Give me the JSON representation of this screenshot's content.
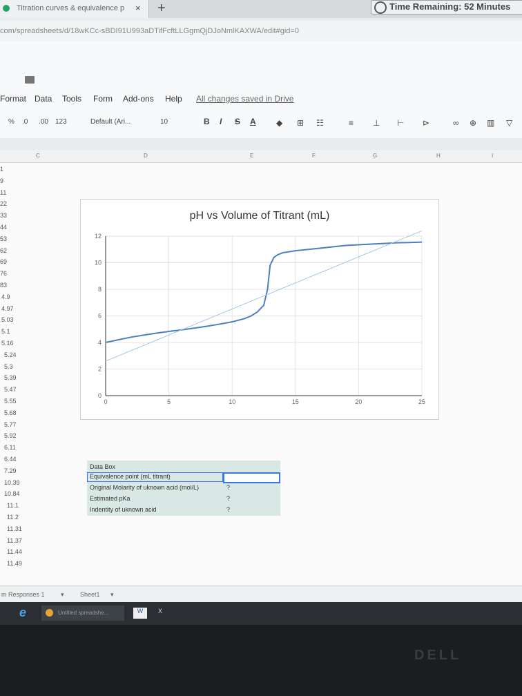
{
  "browser": {
    "tab_title": "Titration curves & equivalence p",
    "tab_close": "×",
    "new_tab": "+",
    "timer": "Time Remaining: 52 Minutes",
    "url": "com/spreadsheets/d/18wKCc-sBDI91U993aDTifFcftLLGgmQjDJoNmlKAXWA/edit#gid=0"
  },
  "menu": {
    "items": [
      "Format",
      "Data",
      "Tools",
      "Form",
      "Add-ons",
      "Help"
    ],
    "saved_status": "All changes saved in Drive"
  },
  "toolbar": {
    "percent": "%",
    "dec_less": ".0",
    "dec_more": ".00",
    "format": "123",
    "font": "Default (Ari...",
    "font_size": "10",
    "bold": "B",
    "italic": "I",
    "strike": "S",
    "text_color": "A"
  },
  "columns": [
    "C",
    "D",
    "E",
    "F",
    "G",
    "H",
    "I"
  ],
  "column_values": [
    "1",
    "9",
    "11",
    "22",
    "33",
    "44",
    "53",
    "62",
    "69",
    "76",
    "83",
    "4.9",
    "4.97",
    "5.03",
    "5.1",
    "5.16",
    "5.24",
    "5.3",
    "5.39",
    "5.47",
    "5.55",
    "5.68",
    "5.77",
    "5.92",
    "6.11",
    "6.44",
    "7.29",
    "10.39",
    "10.84",
    "11.1",
    "11.2",
    "11.31",
    "11.37",
    "11.44",
    "11.49"
  ],
  "chart_data": {
    "type": "line",
    "title": "pH vs Volume of Titrant (mL)",
    "xlabel": "",
    "ylabel": "",
    "xlim": [
      0,
      25
    ],
    "ylim": [
      0,
      12
    ],
    "x_ticks": [
      0,
      5,
      10,
      15,
      20,
      25
    ],
    "y_ticks": [
      0,
      2,
      4,
      6,
      8,
      10,
      12
    ],
    "grid": true,
    "series": [
      {
        "x": [
          0,
          1,
          2,
          3,
          4,
          5,
          6,
          7,
          8,
          9,
          10,
          11,
          11.5,
          12,
          12.5,
          12.8,
          13.0,
          13.3,
          13.6,
          14,
          15,
          16,
          17,
          18,
          19,
          20,
          21,
          22,
          23,
          24,
          25
        ],
        "y": [
          4.0,
          4.2,
          4.4,
          4.55,
          4.7,
          4.83,
          4.95,
          5.08,
          5.22,
          5.38,
          5.55,
          5.8,
          6.0,
          6.3,
          6.8,
          8.0,
          9.8,
          10.4,
          10.6,
          10.75,
          10.9,
          11.0,
          11.1,
          11.2,
          11.3,
          11.35,
          11.4,
          11.45,
          11.5,
          11.52,
          11.55
        ],
        "color": "#4a7fc1"
      },
      {
        "x": [
          0,
          25
        ],
        "y": [
          2.6,
          12.4
        ],
        "color": "#a6c4e6",
        "style": "trendline"
      }
    ]
  },
  "databox": {
    "title": "Data Box",
    "rows": [
      {
        "label": "Equivalence point (mL titrant)",
        "value": ""
      },
      {
        "label": "Original Molarity of uknown acid (mol/L)",
        "value": "?"
      },
      {
        "label": "Estimated pKa",
        "value": "?"
      },
      {
        "label": "Indentity of uknown acid",
        "value": "?"
      }
    ]
  },
  "sheets": [
    "m Responses 1",
    "Sheet1"
  ],
  "taskbar": {
    "chrome_label": "Untitled spreadshe...",
    "word": "W",
    "excel": "X"
  },
  "monitor_brand": "DELL",
  "colors": {
    "accent": "#3b78e7",
    "curve": "#4a7fc1",
    "databox": "#d9e8e4"
  }
}
